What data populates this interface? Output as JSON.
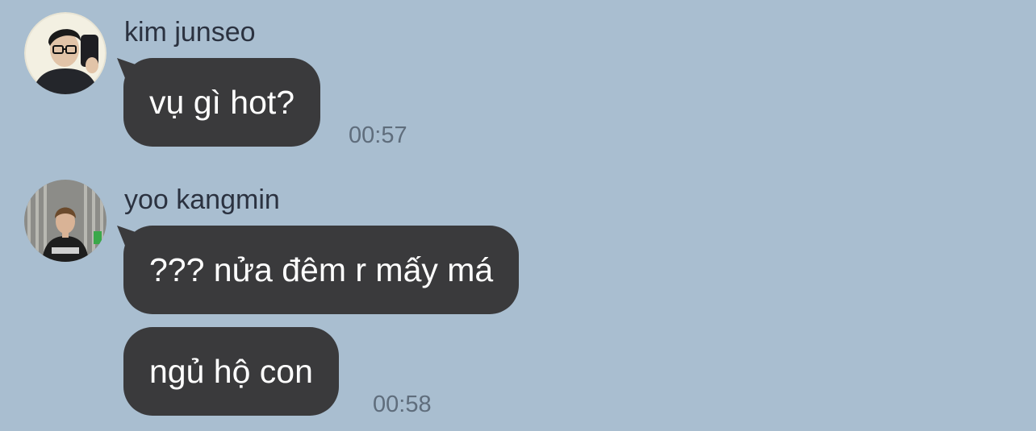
{
  "messages": [
    {
      "sender": "kim junseo",
      "avatar_icon": "profile-photo-icon",
      "bubbles": [
        "vụ gì hot?"
      ],
      "time": "00:57"
    },
    {
      "sender": "yoo kangmin",
      "avatar_icon": "profile-photo-icon",
      "bubbles": [
        "??? nửa đêm r mấy má",
        "ngủ hộ con"
      ],
      "time": "00:58"
    }
  ],
  "colors": {
    "background": "#a9bed0",
    "bubble": "#3a3a3c",
    "bubble_text": "#ffffff",
    "sender_text": "#2b3240",
    "timestamp_text": "#5f6d7c"
  }
}
